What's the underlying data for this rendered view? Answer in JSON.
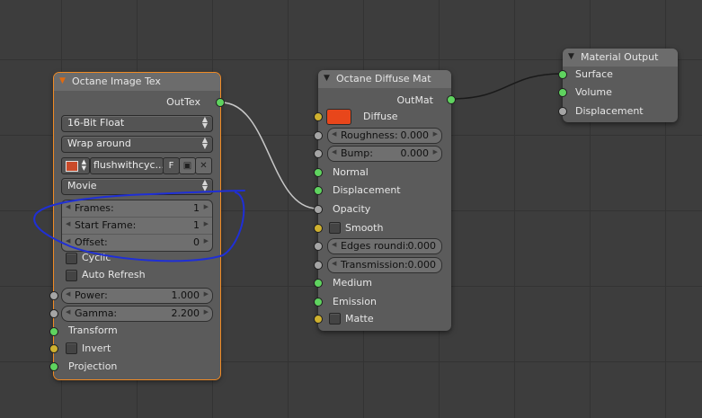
{
  "colors": {
    "socket_green": "#5fd35f",
    "socket_yellow": "#cfb12f",
    "socket_grey": "#a5a5a5",
    "diffuse_swatch": "#e8461b",
    "selection_outline": "#f08a24",
    "annotation": "#1f2fd6"
  },
  "image_tex": {
    "title": "Octane Image Tex",
    "output": "OutTex",
    "bit_depth": "16-Bit Float",
    "wrap_mode": "Wrap around",
    "filename": "flushwithcyc...",
    "file_f_label": "F",
    "source_type": "Movie",
    "frames_label": "Frames:",
    "frames_value": "1",
    "start_frame_label": "Start Frame:",
    "start_frame_value": "1",
    "offset_label": "Offset:",
    "offset_value": "0",
    "cyclic": "Cyclic",
    "auto_refresh": "Auto Refresh",
    "power_label": "Power:",
    "power_value": "1.000",
    "gamma_label": "Gamma:",
    "gamma_value": "2.200",
    "transform": "Transform",
    "invert": "Invert",
    "projection": "Projection",
    "icons": [
      "image-icon",
      "updown-icon",
      "folder-icon",
      "close-icon"
    ]
  },
  "diffuse": {
    "title": "Octane Diffuse Mat",
    "output": "OutMat",
    "diffuse": "Diffuse",
    "roughness_label": "Roughness:",
    "roughness_value": "0.000",
    "bump_label": "Bump:",
    "bump_value": "0.000",
    "normal": "Normal",
    "displacement": "Displacement",
    "opacity": "Opacity",
    "smooth": "Smooth",
    "edges_label": "Edges roundi:",
    "edges_value": "0.000",
    "transmission_label": "Transmission:",
    "transmission_value": "0.000",
    "medium": "Medium",
    "emission": "Emission",
    "matte": "Matte"
  },
  "material_output": {
    "title": "Material Output",
    "surface": "Surface",
    "volume": "Volume",
    "displacement": "Displacement"
  }
}
